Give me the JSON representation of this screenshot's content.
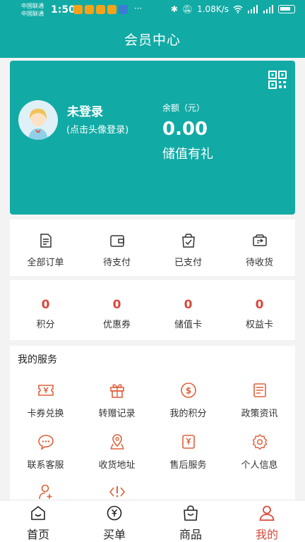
{
  "status_bar": {
    "carrier_1": "中国联通",
    "carrier_2": "中国联通",
    "time": "1:50",
    "more": "···",
    "network_speed": "1.08K/s"
  },
  "header": {
    "title": "会员中心"
  },
  "member_card": {
    "login_title": "未登录",
    "login_hint": "(点击头像登录)",
    "balance_label": "余额（元）",
    "balance_value": "0.00",
    "recharge_label": "储值有礼",
    "qr_icon": "qr-code-icon",
    "accent": "#12aaa5"
  },
  "orders": [
    {
      "label": "全部订单",
      "icon": "document-icon"
    },
    {
      "label": "待支付",
      "icon": "wallet-icon"
    },
    {
      "label": "已支付",
      "icon": "paid-check-icon"
    },
    {
      "label": "待收货",
      "icon": "receive-box-icon"
    }
  ],
  "assets": [
    {
      "value": "0",
      "label": "积分"
    },
    {
      "value": "0",
      "label": "优惠券"
    },
    {
      "value": "0",
      "label": "储值卡"
    },
    {
      "value": "0",
      "label": "权益卡"
    }
  ],
  "services": {
    "title": "我的服务",
    "items": [
      {
        "label": "卡券兑换",
        "icon": "ticket-yen-icon"
      },
      {
        "label": "转赠记录",
        "icon": "gift-icon"
      },
      {
        "label": "我的积分",
        "icon": "coin-dollar-icon"
      },
      {
        "label": "政策资讯",
        "icon": "news-icon"
      },
      {
        "label": "联系客服",
        "icon": "chat-bubble-icon"
      },
      {
        "label": "收货地址",
        "icon": "map-pin-icon"
      },
      {
        "label": "售后服务",
        "icon": "after-sale-icon"
      },
      {
        "label": "个人信息",
        "icon": "settings-gear-icon"
      },
      {
        "label": "",
        "icon": "add-user-icon"
      },
      {
        "label": "",
        "icon": "code-alert-icon"
      }
    ],
    "icon_color": "#e0603a"
  },
  "tabbar": [
    {
      "label": "首页",
      "icon": "home-icon",
      "active": false
    },
    {
      "label": "买单",
      "icon": "pay-bill-icon",
      "active": false
    },
    {
      "label": "商品",
      "icon": "shopping-bag-icon",
      "active": false
    },
    {
      "label": "我的",
      "icon": "user-icon",
      "active": true
    }
  ],
  "colors": {
    "active_tab": "#d9483b",
    "asset_number": "#d9483b"
  }
}
